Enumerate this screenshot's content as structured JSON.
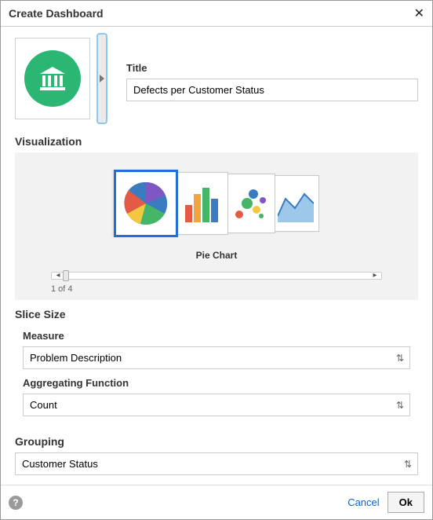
{
  "dialog": {
    "title": "Create Dashboard",
    "close_glyph": "✕"
  },
  "title_field": {
    "label": "Title",
    "value": "Defects per Customer Status"
  },
  "visualization": {
    "heading": "Visualization",
    "selected_label": "Pie Chart",
    "slider_position": "1 of 4"
  },
  "slice_size": {
    "heading": "Slice Size",
    "measure": {
      "label": "Measure",
      "value": "Problem Description"
    },
    "agg": {
      "label": "Aggregating Function",
      "value": "Count"
    }
  },
  "grouping": {
    "heading": "Grouping",
    "value": "Customer Status"
  },
  "footer": {
    "cancel": "Cancel",
    "ok": "Ok"
  }
}
